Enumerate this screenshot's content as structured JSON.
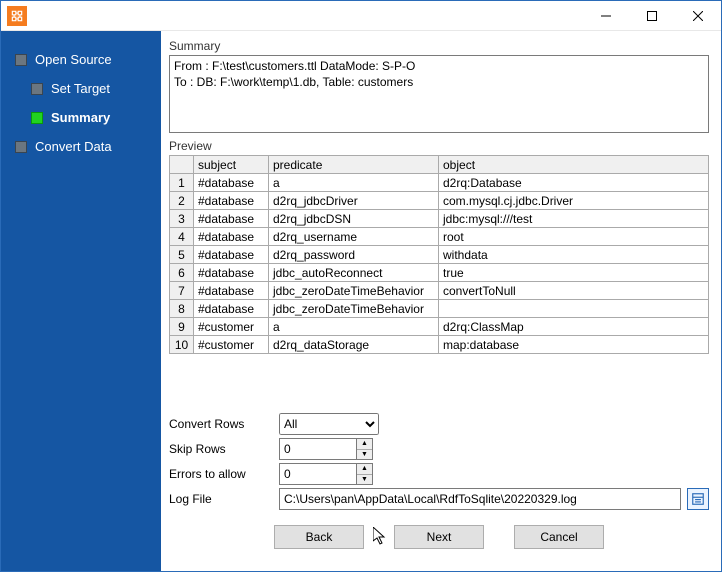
{
  "sidebar": {
    "items": [
      {
        "label": "Open Source"
      },
      {
        "label": "Set Target"
      },
      {
        "label": "Summary"
      },
      {
        "label": "Convert Data"
      }
    ],
    "active_index": 2
  },
  "summary": {
    "heading": "Summary",
    "text": "From : F:\\test\\customers.ttl DataMode: S-P-O\nTo : DB: F:\\work\\temp\\1.db, Table: customers"
  },
  "preview": {
    "heading": "Preview",
    "columns": [
      "subject",
      "predicate",
      "object"
    ],
    "rows": [
      [
        "#database",
        "a",
        "d2rq:Database"
      ],
      [
        "#database",
        "d2rq_jdbcDriver",
        "com.mysql.cj.jdbc.Driver"
      ],
      [
        "#database",
        "d2rq_jdbcDSN",
        "jdbc:mysql:///test"
      ],
      [
        "#database",
        "d2rq_username",
        "root"
      ],
      [
        "#database",
        "d2rq_password",
        "withdata"
      ],
      [
        "#database",
        "jdbc_autoReconnect",
        "true"
      ],
      [
        "#database",
        "jdbc_zeroDateTimeBehavior",
        "convertToNull"
      ],
      [
        "#database",
        "jdbc_zeroDateTimeBehavior",
        ""
      ],
      [
        "#customer",
        "a",
        "d2rq:ClassMap"
      ],
      [
        "#customer",
        "d2rq_dataStorage",
        "map:database"
      ]
    ]
  },
  "options": {
    "convert_rows_label": "Convert Rows",
    "convert_rows_value": "All",
    "skip_rows_label": "Skip Rows",
    "skip_rows_value": "0",
    "errors_label": "Errors to allow",
    "errors_value": "0",
    "log_label": "Log File",
    "log_value": "C:\\Users\\pan\\AppData\\Local\\RdfToSqlite\\20220329.log"
  },
  "buttons": {
    "back": "Back",
    "next": "Next",
    "cancel": "Cancel"
  }
}
